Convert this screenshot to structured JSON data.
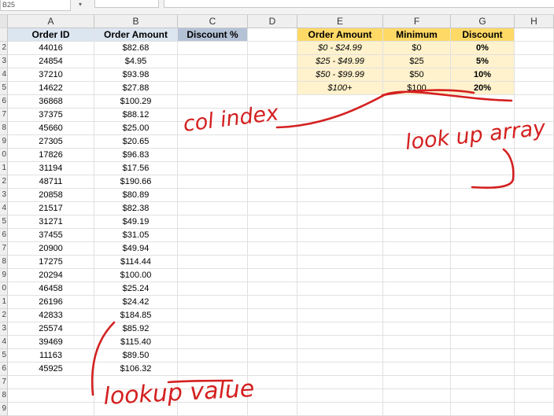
{
  "formula_bar": {
    "name_box": "B25"
  },
  "column_headers": [
    "A",
    "B",
    "C",
    "D",
    "E",
    "F",
    "G",
    "H"
  ],
  "row_numbers": [
    "",
    "2",
    "3",
    "4",
    "5",
    "6",
    "7",
    "8",
    "9",
    "0",
    "1",
    "2",
    "3",
    "4",
    "5",
    "6",
    "7",
    "8",
    "9",
    "0",
    "1",
    "2",
    "3",
    "4",
    "5",
    "6",
    "7",
    "8",
    "9"
  ],
  "table": {
    "headers": {
      "order_id": "Order ID",
      "order_amount": "Order Amount",
      "discount_pct": "Discount %"
    },
    "rows": [
      [
        "44016",
        "$82.68"
      ],
      [
        "24854",
        "$4.95"
      ],
      [
        "37210",
        "$93.98"
      ],
      [
        "14622",
        "$27.88"
      ],
      [
        "36868",
        "$100.29"
      ],
      [
        "37375",
        "$88.12"
      ],
      [
        "45660",
        "$25.00"
      ],
      [
        "27305",
        "$20.65"
      ],
      [
        "17826",
        "$96.83"
      ],
      [
        "31194",
        "$17.56"
      ],
      [
        "48711",
        "$190.66"
      ],
      [
        "20858",
        "$80.89"
      ],
      [
        "21517",
        "$82.38"
      ],
      [
        "31271",
        "$49.19"
      ],
      [
        "37455",
        "$31.05"
      ],
      [
        "20900",
        "$49.94"
      ],
      [
        "17275",
        "$114.44"
      ],
      [
        "20294",
        "$100.00"
      ],
      [
        "46458",
        "$25.24"
      ],
      [
        "26196",
        "$24.42"
      ],
      [
        "42833",
        "$184.85"
      ],
      [
        "25574",
        "$85.92"
      ],
      [
        "39469",
        "$115.40"
      ],
      [
        "11163",
        "$89.50"
      ],
      [
        "45925",
        "$106.32"
      ]
    ]
  },
  "lookup_table": {
    "headers": {
      "order_amount": "Order Amount",
      "minimum": "Minimum",
      "discount": "Discount"
    },
    "rows": [
      [
        "$0 - $24.99",
        "$0",
        "0%"
      ],
      [
        "$25 - $49.99",
        "$25",
        "5%"
      ],
      [
        "$50 - $99.99",
        "$50",
        "10%"
      ],
      [
        "$100+",
        "$100",
        "20%"
      ]
    ]
  },
  "annotations": {
    "col_index": "col index",
    "lookup_array": "look up array",
    "lookup_value": "lookup value",
    "ink_color": "#d42020"
  }
}
